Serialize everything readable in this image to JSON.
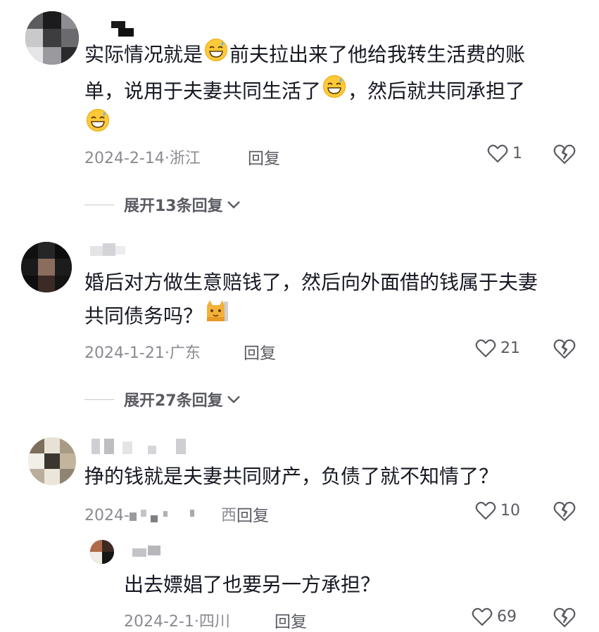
{
  "comments": [
    {
      "text_lines": [
        "实际情况就是",
        "前夫拉出来了他给我转生活费的账",
        "单，说用于夫妻共同生活了",
        "，然后就共同承担了"
      ],
      "date": "2024-2-14",
      "location": "浙江",
      "reply_label": "回复",
      "likes": "1",
      "expand_label": "展开13条回复"
    },
    {
      "text_lines": [
        "婚后对方做生意赔钱了，然后向外面借的钱属于夫妻",
        "共同债务吗？"
      ],
      "date": "2024-1-21",
      "location": "广东",
      "reply_label": "回复",
      "likes": "21",
      "expand_label": "展开27条回复"
    },
    {
      "text_lines": [
        "挣的钱就是夫妻共同财产，负债了就不知情了？"
      ],
      "date_partial": "2024-",
      "location_partial": "西",
      "reply_label": "回复",
      "likes": "10"
    },
    {
      "text_lines": [
        "出去嫖娼了也要另一方承担？"
      ],
      "date": "2024-2-1",
      "location": "四川",
      "reply_label": "回复",
      "likes": "69"
    }
  ],
  "meta_separator": "·",
  "icons": {
    "emoji": "grinning-sweat-emoji",
    "cat": "cat-emoji",
    "like": "heart-outline-icon",
    "dislike": "broken-heart-icon",
    "chevron": "chevron-down-icon"
  },
  "colors": {
    "text": "#161823",
    "meta": "#8a8b91",
    "action": "#5a5b62"
  }
}
